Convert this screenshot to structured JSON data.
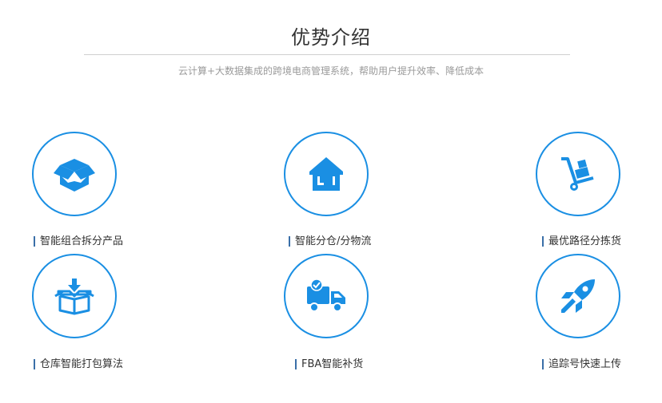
{
  "header": {
    "title": "优势介绍",
    "subtitle": "云计算+大数据集成的跨境电商管理系统，帮助用户提升效率、降低成本"
  },
  "colors": {
    "accent": "#1a8fe3",
    "label_bar": "#3a6fa8"
  },
  "features": [
    {
      "icon": "open-box-icon",
      "label": "智能组合拆分产品"
    },
    {
      "icon": "warehouse-icon",
      "label": "智能分仓/分物流"
    },
    {
      "icon": "hand-truck-icon",
      "label": "最优路径分拣货"
    },
    {
      "icon": "box-download-icon",
      "label": "仓库智能打包算法"
    },
    {
      "icon": "delivery-truck-icon",
      "label": "FBA智能补货"
    },
    {
      "icon": "rocket-icon",
      "label": "追踪号快速上传"
    }
  ]
}
